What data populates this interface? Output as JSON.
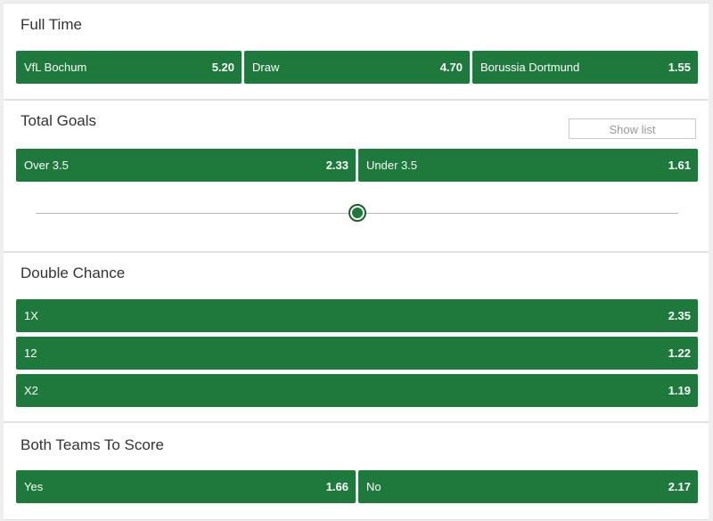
{
  "full_time": {
    "title": "Full Time",
    "outcomes": [
      {
        "label": "VfL Bochum",
        "price": "5.20"
      },
      {
        "label": "Draw",
        "price": "4.70"
      },
      {
        "label": "Borussia Dortmund",
        "price": "1.55"
      }
    ]
  },
  "total_goals": {
    "title": "Total Goals",
    "show_list_label": "Show list",
    "outcomes": [
      {
        "label": "Over 3.5",
        "price": "2.33"
      },
      {
        "label": "Under 3.5",
        "price": "1.61"
      }
    ],
    "slider_position_fraction": 0.5
  },
  "double_chance": {
    "title": "Double Chance",
    "outcomes": [
      {
        "label": "1X",
        "price": "2.35"
      },
      {
        "label": "12",
        "price": "1.22"
      },
      {
        "label": "X2",
        "price": "1.19"
      }
    ]
  },
  "btts": {
    "title": "Both Teams To Score",
    "outcomes": [
      {
        "label": "Yes",
        "price": "1.66"
      },
      {
        "label": "No",
        "price": "2.17"
      }
    ]
  },
  "colors": {
    "odds_button_bg": "#1d7a3c",
    "odds_button_text": "#ffffff",
    "page_bg": "#efefef"
  }
}
